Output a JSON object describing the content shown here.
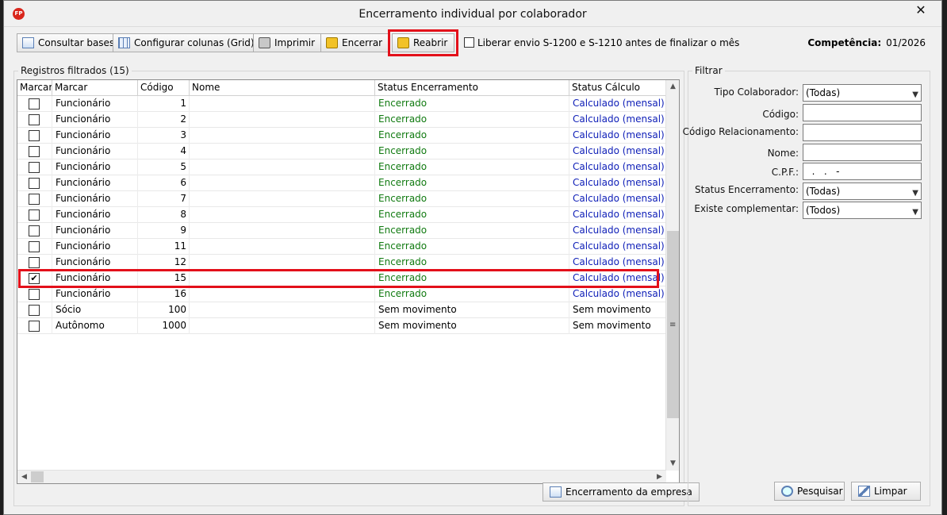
{
  "window": {
    "title": "Encerramento individual por colaborador",
    "app_icon": "FP",
    "close": "✕"
  },
  "toolbar": {
    "consultar": "Consultar bases",
    "configurar": "Configurar colunas (Grid)",
    "imprimir": "Imprimir",
    "encerrar": "Encerrar",
    "reabrir": "Reabrir",
    "liberar": "Liberar envio S-1200 e S-1210 antes de finalizar o mês",
    "competencia_label": "Competência:",
    "competencia_value": "01/2026"
  },
  "grid": {
    "group_label": "Registros filtrados (15)",
    "columns": [
      "Marcar",
      "Marcar",
      "Código",
      "Nome",
      "Status Encerramento",
      "Status Cálculo"
    ],
    "rows": [
      {
        "checked": false,
        "tipo": "Funcionário",
        "codigo": "1",
        "nome": "",
        "status_enc": "Encerrado",
        "status_calc": "Calculado (mensal)"
      },
      {
        "checked": false,
        "tipo": "Funcionário",
        "codigo": "2",
        "nome": "",
        "status_enc": "Encerrado",
        "status_calc": "Calculado (mensal)"
      },
      {
        "checked": false,
        "tipo": "Funcionário",
        "codigo": "3",
        "nome": "",
        "status_enc": "Encerrado",
        "status_calc": "Calculado (mensal)"
      },
      {
        "checked": false,
        "tipo": "Funcionário",
        "codigo": "4",
        "nome": "",
        "status_enc": "Encerrado",
        "status_calc": "Calculado (mensal)"
      },
      {
        "checked": false,
        "tipo": "Funcionário",
        "codigo": "5",
        "nome": "",
        "status_enc": "Encerrado",
        "status_calc": "Calculado (mensal)"
      },
      {
        "checked": false,
        "tipo": "Funcionário",
        "codigo": "6",
        "nome": "",
        "status_enc": "Encerrado",
        "status_calc": "Calculado (mensal)"
      },
      {
        "checked": false,
        "tipo": "Funcionário",
        "codigo": "7",
        "nome": "",
        "status_enc": "Encerrado",
        "status_calc": "Calculado (mensal)"
      },
      {
        "checked": false,
        "tipo": "Funcionário",
        "codigo": "8",
        "nome": "",
        "status_enc": "Encerrado",
        "status_calc": "Calculado (mensal)"
      },
      {
        "checked": false,
        "tipo": "Funcionário",
        "codigo": "9",
        "nome": "",
        "status_enc": "Encerrado",
        "status_calc": "Calculado (mensal)"
      },
      {
        "checked": false,
        "tipo": "Funcionário",
        "codigo": "11",
        "nome": "",
        "status_enc": "Encerrado",
        "status_calc": "Calculado (mensal)"
      },
      {
        "checked": false,
        "tipo": "Funcionário",
        "codigo": "12",
        "nome": "",
        "status_enc": "Encerrado",
        "status_calc": "Calculado (mensal)"
      },
      {
        "checked": true,
        "tipo": "Funcionário",
        "codigo": "15",
        "nome": "",
        "status_enc": "Encerrado",
        "status_calc": "Calculado (mensal)"
      },
      {
        "checked": false,
        "tipo": "Funcionário",
        "codigo": "16",
        "nome": "",
        "status_enc": "Encerrado",
        "status_calc": "Calculado (mensal)"
      },
      {
        "checked": false,
        "tipo": "Sócio",
        "codigo": "100",
        "nome": "",
        "status_enc": "Sem movimento",
        "status_calc": "Sem movimento"
      },
      {
        "checked": false,
        "tipo": "Autônomo",
        "codigo": "1000",
        "nome": "",
        "status_enc": "Sem movimento",
        "status_calc": "Sem movimento"
      }
    ],
    "encerramento_empresa": "Encerramento da empresa"
  },
  "filter": {
    "group_label": "Filtrar",
    "tipo_label": "Tipo Colaborador:",
    "tipo_value": "(Todas)",
    "codigo_label": "Código:",
    "codigo_rel_label": "Código Relacionamento:",
    "nome_label": "Nome:",
    "cpf_label": "C.P.F.:",
    "cpf_value": "  .   .   -",
    "status_label": "Status Encerramento:",
    "status_value": "(Todas)",
    "complementar_label": "Existe complementar:",
    "complementar_value": "(Todos)",
    "pesquisar": "Pesquisar",
    "limpar": "Limpar"
  },
  "colors": {
    "green": "#107a10",
    "blue": "#1020b8",
    "highlight": "#e3101a"
  }
}
